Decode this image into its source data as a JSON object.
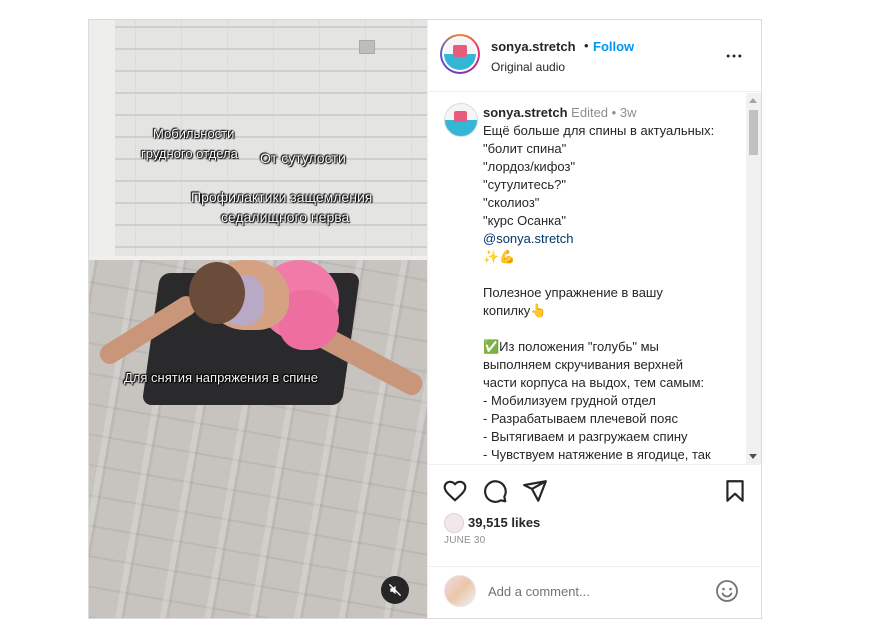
{
  "video": {
    "overlays": [
      "Мобильности",
      "грудного отдела",
      "От сутулости",
      "Профилактики защемления",
      "седалищного нерва",
      "Для снятия напряжения в спине"
    ]
  },
  "header": {
    "username": "sonya.stretch",
    "dot": "•",
    "follow": "Follow",
    "audio": "Original audio"
  },
  "caption": {
    "username": "sonya.stretch",
    "edited": "Edited",
    "dot": "•",
    "time": "3w",
    "lines": [
      "Ещё больше для спины в актуальных:",
      "\"болит спина\"",
      "\"лордоз/кифоз\"",
      "\"сутулитесь?\"",
      "\"сколиоз\"",
      "\"курс Осанка\""
    ],
    "mention": "@sonya.stretch",
    "emoji_line": "✨💪",
    "para2": [
      "Полезное упражнение в вашу",
      "копилку👆"
    ],
    "para3": [
      "✅Из положения \"голубь\" мы",
      "выполняем скручивания верхней",
      "части корпуса на выдох, тем самым:",
      "- Мобилизуем грудной отдел",
      "- Разрабатываем плечевой пояс",
      "- Вытягиваем и разгружаем спину",
      "- Чувствуем натяжение в ягодице, так"
    ]
  },
  "stats": {
    "likes": "39,515 likes",
    "date": "JUNE 30"
  },
  "comment": {
    "placeholder": "Add a comment..."
  },
  "colors": {
    "accent": "#0095f6",
    "text": "#262626",
    "muted": "#8e8e8e",
    "border": "#dbdbdb"
  },
  "icons": [
    "heart-icon",
    "comment-icon",
    "share-icon",
    "bookmark-icon",
    "more-icon",
    "mute-icon",
    "emoji-icon"
  ]
}
